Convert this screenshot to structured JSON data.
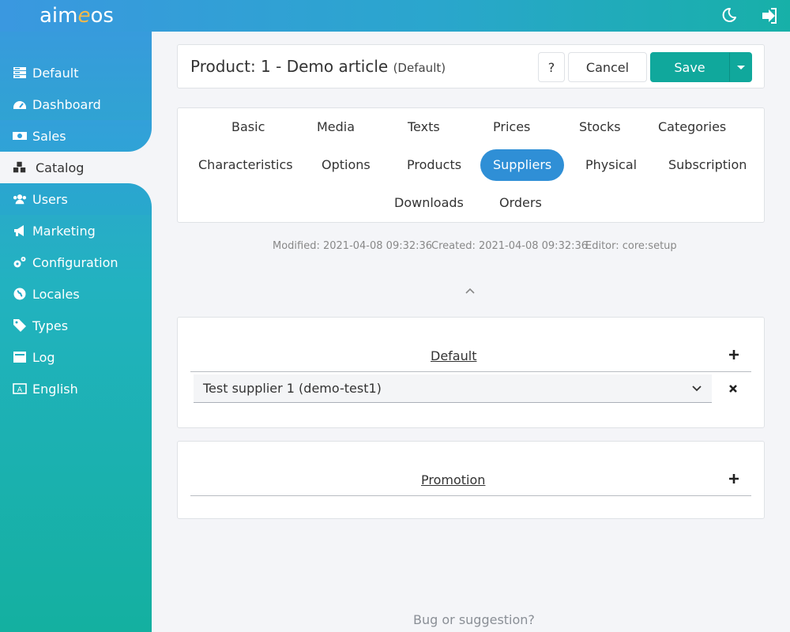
{
  "app": {
    "logo_prefix": "aim",
    "logo_e": "e",
    "logo_suffix": "os"
  },
  "topbar": {
    "icons": [
      "moon-icon",
      "logout-icon"
    ]
  },
  "sidebar": {
    "items": [
      {
        "label": "Default",
        "icon": "server-icon"
      },
      {
        "label": "Dashboard",
        "icon": "dashboard-icon"
      },
      {
        "label": "Sales",
        "icon": "money-icon"
      },
      {
        "label": "Catalog",
        "icon": "cubes-icon",
        "active": true
      },
      {
        "label": "Users",
        "icon": "users-icon"
      },
      {
        "label": "Marketing",
        "icon": "bullhorn-icon"
      },
      {
        "label": "Configuration",
        "icon": "cogs-icon"
      },
      {
        "label": "Locales",
        "icon": "globe-icon"
      },
      {
        "label": "Types",
        "icon": "tags-icon"
      },
      {
        "label": "Log",
        "icon": "inbox-icon"
      },
      {
        "label": "English",
        "icon": "language-icon"
      }
    ]
  },
  "header": {
    "title": "Product: 1 - Demo article",
    "site": "(Default)",
    "help_label": "?",
    "cancel_label": "Cancel",
    "save_label": "Save"
  },
  "tabs": [
    {
      "label": "Basic"
    },
    {
      "label": "Media"
    },
    {
      "label": "Texts"
    },
    {
      "label": "Prices"
    },
    {
      "label": "Stocks"
    },
    {
      "label": "Categories"
    },
    {
      "label": "Characteristics"
    },
    {
      "label": "Options"
    },
    {
      "label": "Products"
    },
    {
      "label": "Suppliers",
      "active": true
    },
    {
      "label": "Physical"
    },
    {
      "label": "Subscription"
    },
    {
      "label": "Downloads"
    },
    {
      "label": "Orders"
    }
  ],
  "meta": {
    "modified": "Modified: 2021-04-08 09:32:36",
    "created": "Created: 2021-04-08 09:32:36",
    "editor": "Editor: core:setup"
  },
  "groups": [
    {
      "title": "Default",
      "items": [
        {
          "value": "Test supplier 1 (demo-test1)"
        }
      ]
    },
    {
      "title": "Promotion",
      "items": []
    }
  ],
  "footer": {
    "label": "Bug or suggestion?"
  },
  "colors": {
    "accent": "#2f8fd6",
    "save": "#10a89c",
    "sidebar_top": "#3a98e0",
    "sidebar_bottom": "#14b0a0"
  }
}
